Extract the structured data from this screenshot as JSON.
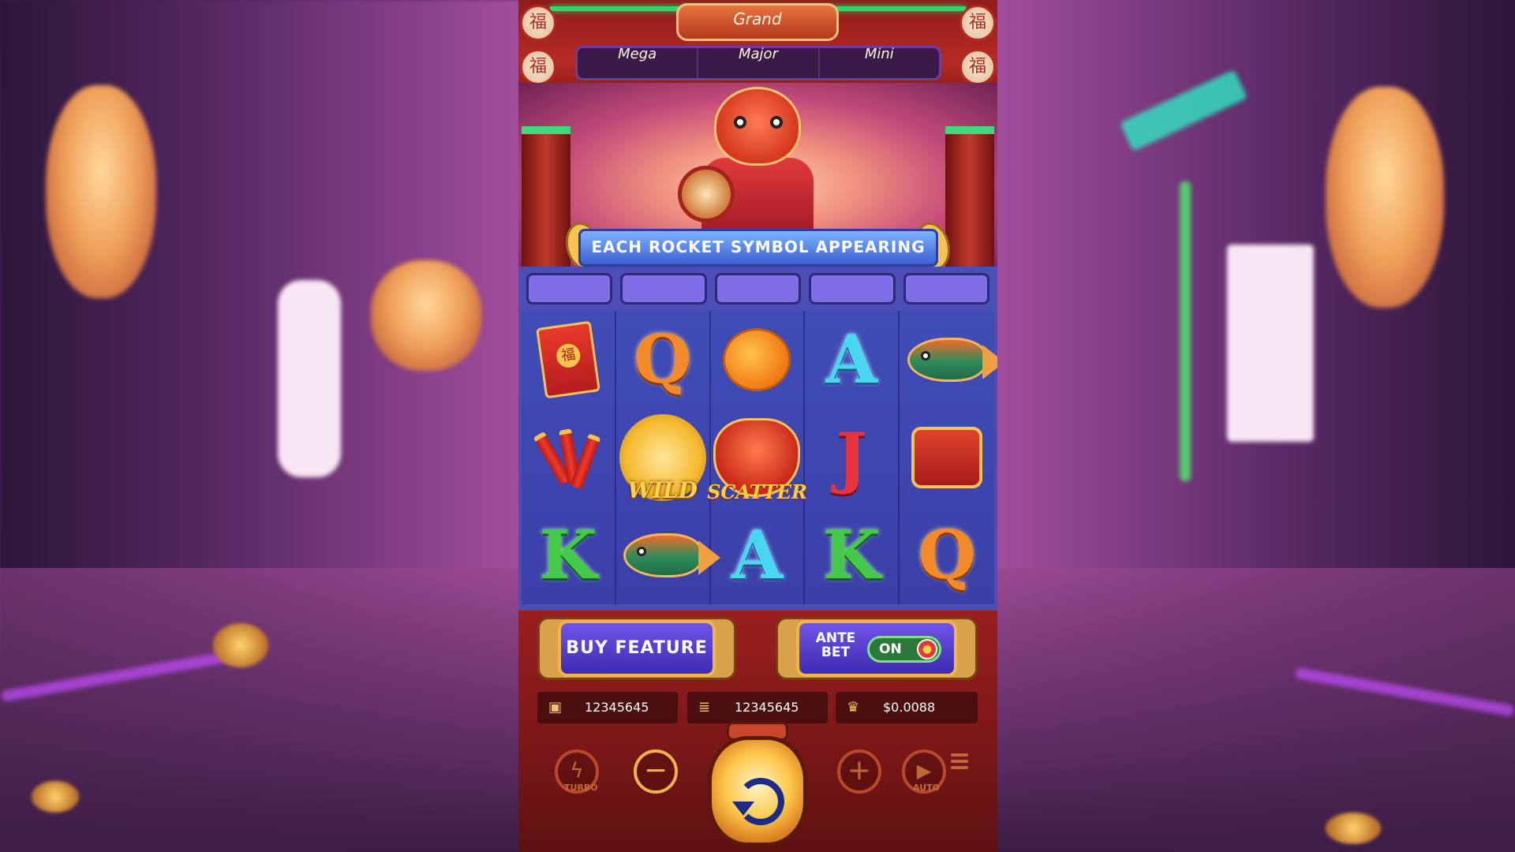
{
  "jackpots": {
    "grand": "Grand",
    "mega": "Mega",
    "major": "Major",
    "mini": "Mini"
  },
  "banner": {
    "text": "EACH ROCKET SYMBOL APPEARING"
  },
  "reels": [
    [
      "envelope-symbol",
      "q-symbol",
      "orange-symbol",
      "a-symbol",
      "koi-fish-symbol"
    ],
    [
      "firecracker-symbol",
      "wild-symbol",
      "scatter-symbol",
      "j-symbol",
      "drum-symbol"
    ],
    [
      "k-symbol",
      "koi-fish-symbol",
      "a-symbol",
      "k-symbol",
      "q-symbol"
    ]
  ],
  "symbols": {
    "q": "Q",
    "a": "A",
    "j": "J",
    "k": "K",
    "wild": "WILD",
    "scatter": "SCATTER",
    "fu": "福"
  },
  "buttons": {
    "buy_feature": "BUY FEATURE",
    "ante_bet": "ANTE BET",
    "ante_toggle": "ON",
    "turbo": "TURBO",
    "auto": "AUTO"
  },
  "stats": {
    "balance": "12345645",
    "bet": "12345645",
    "win": "$0.0088"
  },
  "icons": {
    "balance": "wallet-icon",
    "bet": "coins-icon",
    "win": "trophy-icon"
  },
  "colors": {
    "panel_red": "#7c1d1d",
    "reel_blue": "#414db7",
    "button_purple": "#5a45d0",
    "accent_gold": "#f2b34a",
    "neon_green": "#2ad96b"
  }
}
